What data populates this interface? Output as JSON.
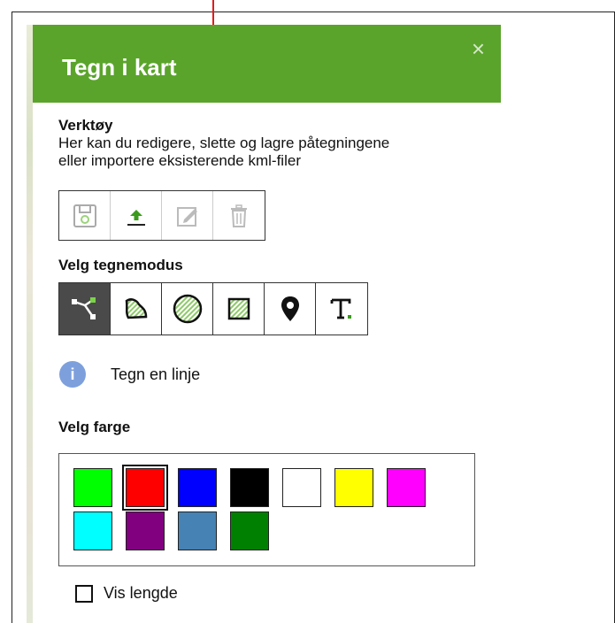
{
  "panel": {
    "title": "Tegn i kart",
    "close_label": "×",
    "header_color": "#5aa42b"
  },
  "tools_section": {
    "title": "Verktøy",
    "description_line1": "Her kan du redigere, slette og lagre påtegningene",
    "description_line2": "eller importere eksisterende kml-filer",
    "buttons": [
      {
        "name": "save-icon",
        "enabled": false
      },
      {
        "name": "upload-icon",
        "enabled": true
      },
      {
        "name": "edit-icon",
        "enabled": false
      },
      {
        "name": "trash-icon",
        "enabled": false
      }
    ]
  },
  "draw_mode": {
    "title": "Velg tegnemodus",
    "modes": [
      {
        "name": "line-mode-icon",
        "active": true
      },
      {
        "name": "freehand-polygon-icon",
        "active": false
      },
      {
        "name": "circle-icon",
        "active": false
      },
      {
        "name": "rectangle-icon",
        "active": false
      },
      {
        "name": "marker-pin-icon",
        "active": false
      },
      {
        "name": "text-icon",
        "active": false
      }
    ]
  },
  "info": {
    "icon_label": "i",
    "text": "Tegn en linje"
  },
  "colors": {
    "title": "Velg farge",
    "selected_index": 1,
    "swatches": [
      "#00ff00",
      "#ff0000",
      "#0000ff",
      "#000000",
      "#ffffff",
      "#ffff00",
      "#ff00ff",
      "#00ffff",
      "#800080",
      "#4682b4",
      "#008000"
    ]
  },
  "show_length": {
    "label": "Vis lengde",
    "checked": false
  },
  "annotation": {
    "arrow_color": "#e21b1b"
  }
}
